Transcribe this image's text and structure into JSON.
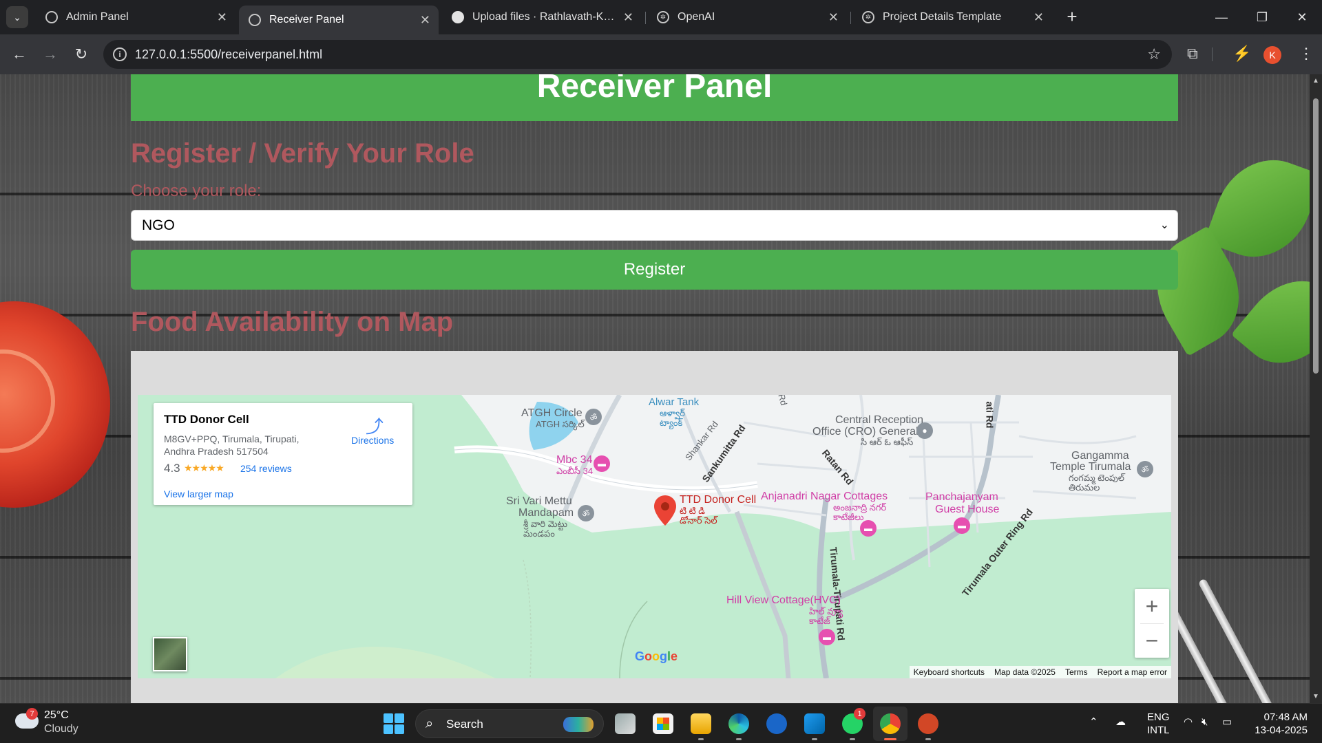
{
  "browser": {
    "tabs": [
      {
        "title": "Admin Panel",
        "favicon": "globe-icon",
        "active": false
      },
      {
        "title": "Receiver Panel",
        "favicon": "globe-icon",
        "active": true
      },
      {
        "title": "Upload files · Rathlavath-Kavya",
        "favicon": "github-icon",
        "active": false
      },
      {
        "title": "OpenAI",
        "favicon": "openai-icon",
        "active": false
      },
      {
        "title": "Project Details Template",
        "favicon": "openai-icon",
        "active": false
      }
    ],
    "url": "127.0.0.1:5500/receiverpanel.html",
    "profile_initial": "K"
  },
  "page": {
    "header_title": "Receiver Panel",
    "register_heading": "Register / Verify Your Role",
    "role_label": "Choose your role:",
    "role_selected": "NGO",
    "register_button": "Register",
    "map_heading": "Food Availability on Map",
    "colors": {
      "green": "#4caf50",
      "heading": "#b0585e"
    }
  },
  "map": {
    "place_name": "TTD Donor Cell",
    "address": "M8GV+PPQ, Tirumala, Tirupati, Andhra Pradesh 517504",
    "rating": "4.3",
    "stars": "★★★★★",
    "reviews": "254 reviews",
    "directions": "Directions",
    "view_larger": "View larger map",
    "labels": {
      "atgh": "ATGH Circle",
      "atgh_te": "ATGH సర్కిల్",
      "alwar": "Alwar Tank",
      "alwar_te": "ఆళ్వార్ ట్యాంక్",
      "shankar": "Shankar Rd",
      "sankumitta": "Sankumitta Rd",
      "cro1": "Central Reception",
      "cro2": "Office (CRO) General",
      "cro_te": "సి ఆర్ ఓ ఆఫీస్",
      "ratan": "Ratan Rd",
      "gangamma1": "Gangamma",
      "gangamma2": "Temple Tirumala",
      "gangamma_te": "గంగమ్మ టెంపుల్ తిరుమల",
      "mbc": "Mbc 34",
      "mbc_te": "ఎంబీసీ 34",
      "srivari1": "Sri Vari Mettu",
      "srivari2": "Mandapam",
      "srivari_te": "శ్రీ వారి మెట్టు మండపం",
      "ttd": "TTD Donor Cell",
      "ttd_te": "టి టి డి డోనార్ సెల్",
      "anjanadri": "Anjanadri Nagar Cottages",
      "anjanadri_te": "అంజనాద్రి నగర్ కాటేజీలు",
      "panch1": "Panchajanyam",
      "panch2": "Guest House",
      "tirupati_rd": "Tirumala-Tirupati Rd",
      "outer_ring": "Tirumala Outer Ring Rd",
      "hillview": "Hill View Cottage(HVC)",
      "hillview_te": "హిల్ వ్యూ కాటేజ్",
      "rd_top": "Rd",
      "ati_rd": "ati Rd"
    },
    "zoom_in": "+",
    "zoom_out": "−",
    "google": "Google",
    "attribution": [
      "Keyboard shortcuts",
      "Map data ©2025",
      "Terms",
      "Report a map error"
    ]
  },
  "taskbar": {
    "weather_temp": "25°C",
    "weather_desc": "Cloudy",
    "weather_badge": "7",
    "search": "Search",
    "whatsapp_badge": "1",
    "lang1": "ENG",
    "lang2": "INTL",
    "time": "07:48 AM",
    "date": "13-04-2025"
  }
}
